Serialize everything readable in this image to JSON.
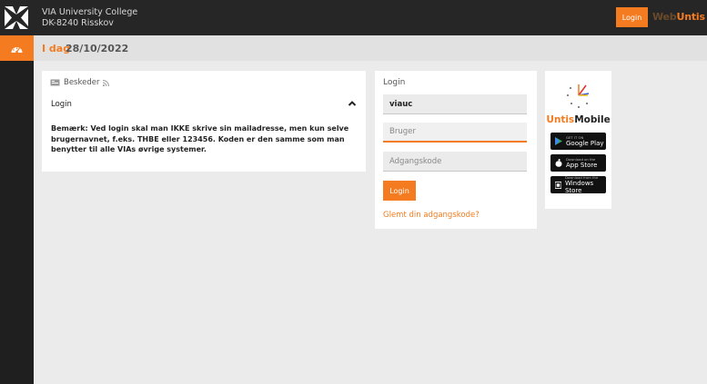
{
  "header": {
    "school_name": "VIA University College",
    "school_address": "DK-8240 Risskov",
    "login_button": "Login",
    "brand_part1": "Web",
    "brand_part2": "Untis"
  },
  "datebar": {
    "label": "I dag",
    "date": "28/10/2022"
  },
  "messages": {
    "title": "Beskeder",
    "section_label": "Login",
    "text": "Bemærk: Ved login skal man IKKE skrive sin mailadresse, men kun selve brugernavnet, f.eks. THBE eller 123456. Koden er den samme som man benytter til alle VIAs øvrige systemer."
  },
  "login": {
    "title": "Login",
    "school_value": "viauc",
    "user_placeholder": "Bruger",
    "password_placeholder": "Adgangskode",
    "button": "Login",
    "forgot_link": "Glemt din adgangskode?"
  },
  "mobile": {
    "title_part1": "Untis",
    "title_part2": "Mobile",
    "stores": [
      {
        "small": "GET IT ON",
        "name": "Google Play",
        "icon": "google-play-icon"
      },
      {
        "small": "Download on the",
        "name": "App Store",
        "icon": "apple-icon"
      },
      {
        "small": "Download from the",
        "name": "Windows Store",
        "icon": "windows-icon"
      }
    ]
  },
  "colors": {
    "accent": "#f47b20",
    "topbar": "#262626",
    "sidebar": "#1f1f1f"
  }
}
